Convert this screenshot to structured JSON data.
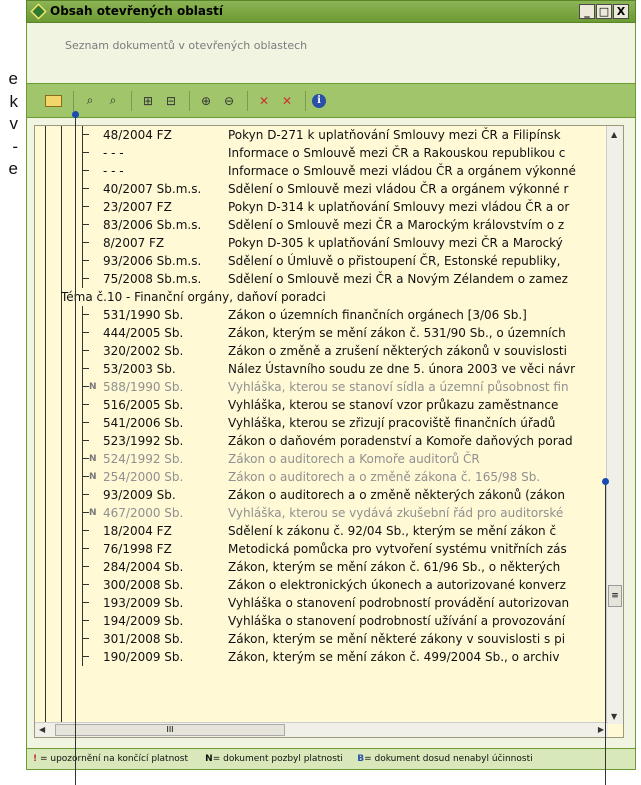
{
  "side_text": [
    "e",
    "k",
    "v",
    "-",
    "e"
  ],
  "window": {
    "title": "Obsah otevřených oblastí",
    "subtitle": "Seznam dokumentů v otevřených oblastech",
    "buttons": [
      "_",
      "□",
      "X"
    ]
  },
  "toolbar": {
    "icons": [
      "open-folder-icon",
      "binoculars-icon",
      "binoculars-next-icon",
      "expand-tree-icon",
      "collapse-tree-icon",
      "expand-node-icon",
      "collapse-node-icon",
      "remove-item-icon",
      "remove-all-icon",
      "info-icon"
    ]
  },
  "rows": [
    {
      "num": "48/2004 FZ",
      "desc": "Pokyn D-271 k uplatňování Smlouvy mezi ČR a Filipínsk",
      "flag": ""
    },
    {
      "num": "- - -",
      "desc": "Informace o Smlouvě mezi ČR a Rakouskou republikou c",
      "flag": ""
    },
    {
      "num": "- - -",
      "desc": "Informace o Smlouvě mezi vládou ČR a orgánem výkonné",
      "flag": ""
    },
    {
      "num": "40/2007 Sb.m.s.",
      "desc": "Sdělení o Smlouvě mezi vládou ČR a orgánem výkonné r",
      "flag": ""
    },
    {
      "num": "23/2007 FZ",
      "desc": "Pokyn D-314 k uplatňování Smlouvy mezi vládou ČR a or",
      "flag": ""
    },
    {
      "num": "83/2006 Sb.m.s.",
      "desc": "Sdělení o Smlouvě mezi ČR a Marockým královstvím o z",
      "flag": ""
    },
    {
      "num": "8/2007 FZ",
      "desc": "Pokyn D-305 k uplatňování Smlouvy mezi ČR a Marocký",
      "flag": ""
    },
    {
      "num": "93/2006 Sb.m.s.",
      "desc": "Sdělení o Úmluvě o přistoupení ČR, Estonské republiky,",
      "flag": ""
    },
    {
      "num": "75/2008 Sb.m.s.",
      "desc": "Sdělení o Smlouvě mezi ČR a Novým Zélandem o zamez",
      "flag": ""
    },
    {
      "category": "Téma č.10 - Finanční orgány, daňoví poradci"
    },
    {
      "num": "531/1990 Sb.",
      "desc": "Zákon o územních finančních orgánech [3/06 Sb.]",
      "flag": ""
    },
    {
      "num": "444/2005 Sb.",
      "desc": "Zákon, kterým se mění zákon č. 531/90 Sb., o územních",
      "flag": ""
    },
    {
      "num": "320/2002 Sb.",
      "desc": "Zákon o změně a zrušení některých zákonů v souvislosti",
      "flag": ""
    },
    {
      "num": "53/2003 Sb.",
      "desc": "Nález Ústavního soudu ze dne 5. února 2003 ve věci návr",
      "flag": ""
    },
    {
      "num": "588/1990 Sb.",
      "desc": "Vyhláška, kterou se stanoví sídla a územní působnost fin",
      "flag": "N"
    },
    {
      "num": "516/2005 Sb.",
      "desc": "Vyhláška, kterou se stanoví vzor průkazu zaměstnance",
      "flag": ""
    },
    {
      "num": "541/2006 Sb.",
      "desc": "Vyhláška, kterou se zřizují pracoviště finančních úřadů",
      "flag": ""
    },
    {
      "num": "523/1992 Sb.",
      "desc": "Zákon o daňovém poradenství a Komoře daňových porad",
      "flag": ""
    },
    {
      "num": "524/1992 Sb.",
      "desc": "Zákon o auditorech a Komoře auditorů ČR",
      "flag": "N"
    },
    {
      "num": "254/2000 Sb.",
      "desc": "Zákon o auditorech a o změně zákona č. 165/98 Sb.",
      "flag": "N"
    },
    {
      "num": "93/2009 Sb.",
      "desc": "Zákon o auditorech a o změně některých zákonů (zákon",
      "flag": ""
    },
    {
      "num": "467/2000 Sb.",
      "desc": "Vyhláška, kterou se vydává zkušební řád pro auditorské",
      "flag": "N"
    },
    {
      "num": "18/2004 FZ",
      "desc": "Sdělení k zákonu č. 92/04 Sb., kterým se mění zákon č",
      "flag": ""
    },
    {
      "num": "76/1998 FZ",
      "desc": "Metodická pomůcka pro vytvoření systému vnitřních zás",
      "flag": ""
    },
    {
      "num": "284/2004 Sb.",
      "desc": "Zákon, kterým se mění zákon č. 61/96 Sb., o některých",
      "flag": ""
    },
    {
      "num": "300/2008 Sb.",
      "desc": "Zákon o elektronických úkonech a autorizované konverz",
      "flag": ""
    },
    {
      "num": "193/2009 Sb.",
      "desc": "Vyhláška o stanovení podrobností provádění autorizovan",
      "flag": ""
    },
    {
      "num": "194/2009 Sb.",
      "desc": "Vyhláška o stanovení podrobností užívání a provozování",
      "flag": ""
    },
    {
      "num": "301/2008 Sb.",
      "desc": "Zákon, kterým se mění některé zákony v souvislosti s pi",
      "flag": ""
    },
    {
      "num": "190/2009 Sb.",
      "desc": "Zákon, kterým se mění zákon č. 499/2004 Sb., o archiv",
      "flag": ""
    }
  ],
  "scroll": {
    "thumb": "≡",
    "hthumb": "III"
  },
  "legend": {
    "a_mark": "!",
    "a_text": " = upozornění na končící platnost",
    "b_mark": "N",
    "b_text": "= dokument pozbyl platnosti",
    "c_mark": "B",
    "c_text": "= dokument dosud nenabyl účinnosti"
  }
}
